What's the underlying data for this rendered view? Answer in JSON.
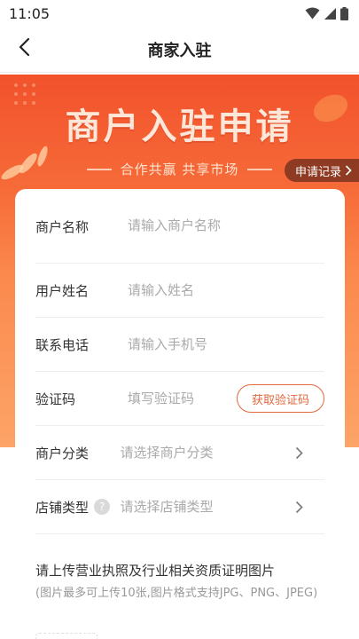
{
  "status_bar": {
    "time": "11:05"
  },
  "nav": {
    "title": "商家入驻"
  },
  "hero": {
    "title": "商户入驻申请",
    "subtitle": "合作共赢  共享市场",
    "record_label": "申请记录"
  },
  "form": {
    "merchant_name": {
      "label": "商户名称",
      "placeholder": "请输入商户名称"
    },
    "user_name": {
      "label": "用户姓名",
      "placeholder": "请输入姓名"
    },
    "phone": {
      "label": "联系电话",
      "placeholder": "请输入手机号"
    },
    "code": {
      "label": "验证码",
      "placeholder": "填写验证码",
      "button": "获取验证码"
    },
    "category": {
      "label": "商户分类",
      "placeholder": "请选择商户分类"
    },
    "shop_type": {
      "label": "店铺类型",
      "placeholder": "请选择店铺类型"
    }
  },
  "upload": {
    "title": "请上传营业执照及行业相关资质证明图片",
    "note": "(图片最多可上传10张,图片格式支持JPG、PNG、JPEG)"
  },
  "colors": {
    "accent": "#f2522c",
    "button_border": "#e2683d",
    "badge_bg": "#8f3a22"
  },
  "icons": [
    "wifi-icon",
    "signal-icon",
    "battery-icon",
    "back-arrow-icon",
    "chevron-right-icon",
    "help-icon"
  ]
}
